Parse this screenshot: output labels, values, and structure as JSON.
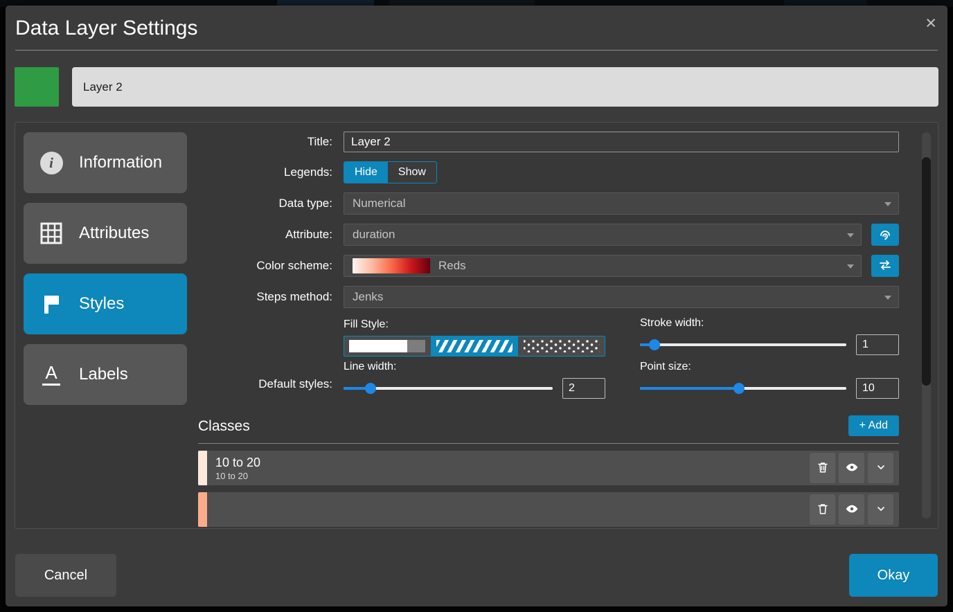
{
  "modal": {
    "title": "Data Layer Settings",
    "close_glyph": "×",
    "layer": {
      "name": "Layer 2",
      "color": "#2f9b44"
    },
    "sidebar": {
      "items": [
        {
          "label": "Information",
          "glyph": "i"
        },
        {
          "label": "Attributes"
        },
        {
          "label": "Styles",
          "active": true
        },
        {
          "label": "Labels",
          "glyph": "A"
        }
      ]
    },
    "form": {
      "title": {
        "label": "Title:",
        "value": "Layer 2"
      },
      "legends": {
        "label": "Legends:",
        "options": [
          "Hide",
          "Show"
        ],
        "selected": "Hide"
      },
      "data_type": {
        "label": "Data type:",
        "value": "Numerical"
      },
      "attribute": {
        "label": "Attribute:",
        "value": "duration"
      },
      "color_scheme": {
        "label": "Color scheme:",
        "value": "Reds",
        "swatches": [
          "#fff5f0",
          "#fcbba1",
          "#fb6a4a",
          "#cb181d",
          "#67000d"
        ]
      },
      "steps_method": {
        "label": "Steps method:",
        "value": "Jenks"
      },
      "fill_style": {
        "label": "Fill Style:",
        "options": [
          "solid",
          "hatch",
          "dots"
        ],
        "selected": "hatch"
      },
      "stroke_width": {
        "label": "Stroke width:",
        "value": "1",
        "pct": 7
      },
      "default_styles_label": "Default styles:",
      "line_width": {
        "label": "Line width:",
        "value": "2",
        "pct": 13
      },
      "point_size": {
        "label": "Point size:",
        "value": "10",
        "pct": 48
      }
    },
    "classes": {
      "heading": "Classes",
      "add_label": "+ Add",
      "rows": [
        {
          "title": "10 to 20",
          "subtitle": "10 to 20",
          "color": "#fde8dc"
        },
        {
          "title": "",
          "subtitle": "",
          "color": "#fcab8a"
        }
      ]
    },
    "footer": {
      "cancel_label": "Cancel",
      "okay_label": "Okay"
    }
  }
}
